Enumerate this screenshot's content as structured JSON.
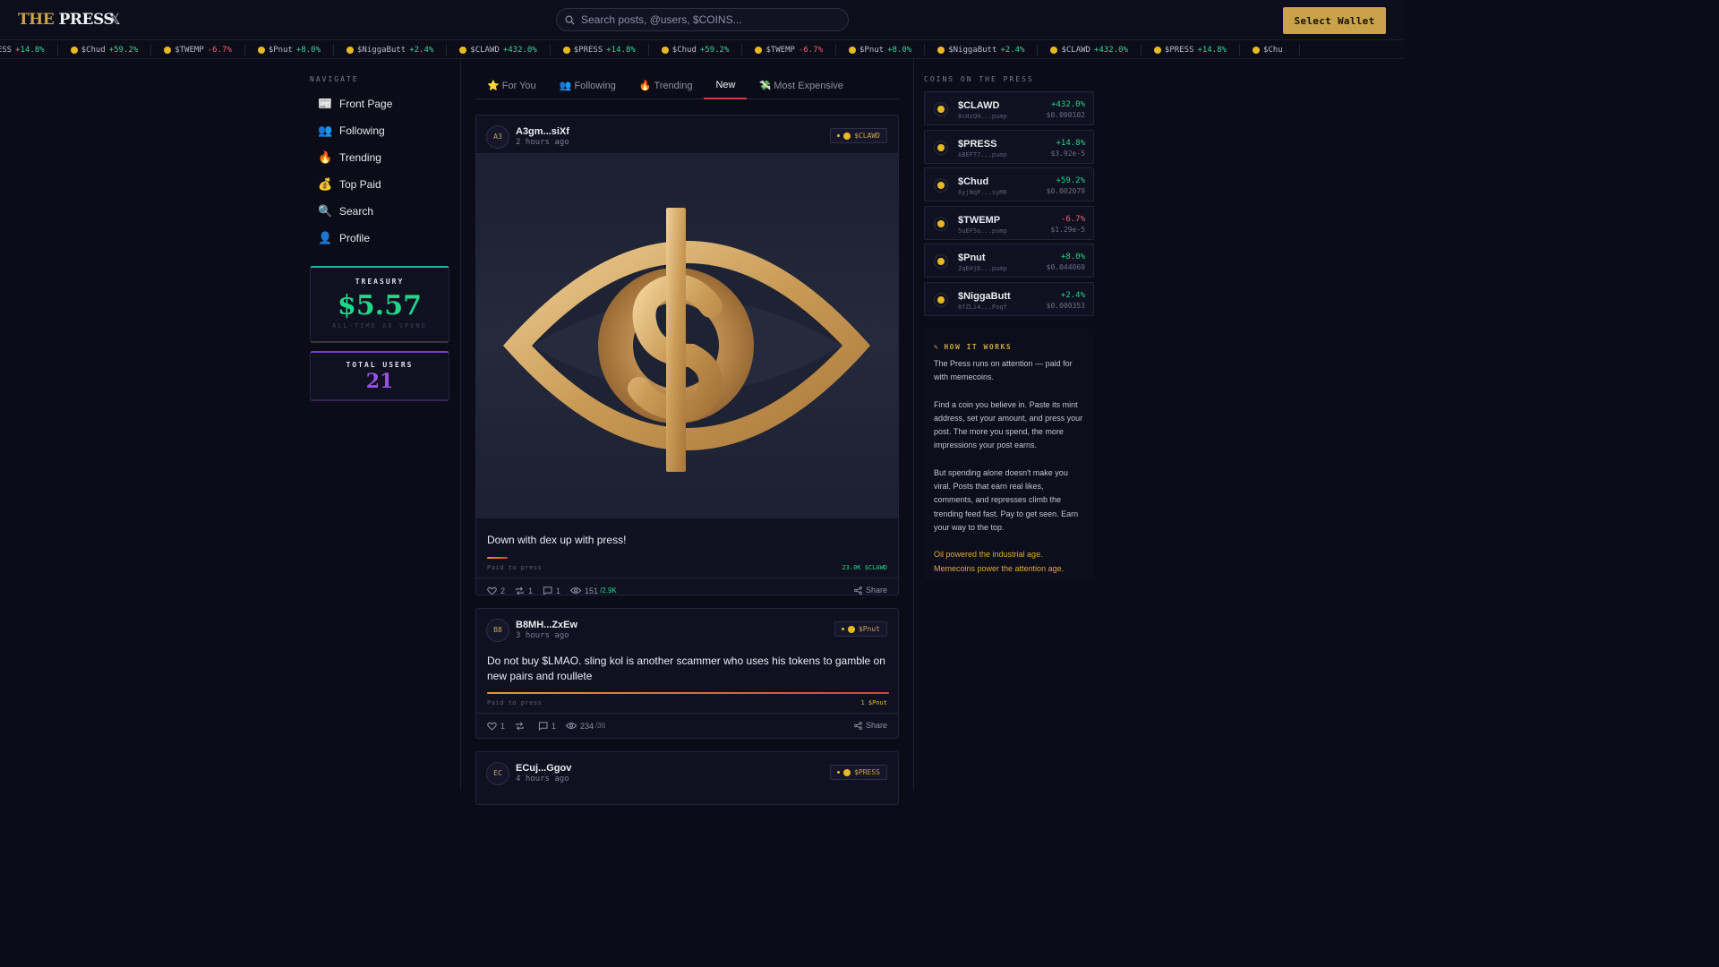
{
  "header": {
    "logo_the": "THE",
    "logo_press": "PRESS",
    "x_icon": "x-logo-icon",
    "search_placeholder": "Search posts, @users, $COINS...",
    "wallet_label": "Select Wallet"
  },
  "ticker": [
    {
      "symbol": "PRESS",
      "change": "+14.8%",
      "dir": "pos",
      "coin": false
    },
    {
      "symbol": "$Chud",
      "change": "+59.2%",
      "dir": "pos",
      "coin": true
    },
    {
      "symbol": "$TWEMP",
      "change": "-6.7%",
      "dir": "neg",
      "coin": true
    },
    {
      "symbol": "$Pnut",
      "change": "+8.0%",
      "dir": "pos",
      "coin": true
    },
    {
      "symbol": "$NiggaButt",
      "change": "+2.4%",
      "dir": "pos",
      "coin": true
    },
    {
      "symbol": "$CLAWD",
      "change": "+432.0%",
      "dir": "pos",
      "coin": true
    },
    {
      "symbol": "$PRESS",
      "change": "+14.8%",
      "dir": "pos",
      "coin": true
    },
    {
      "symbol": "$Chud",
      "change": "+59.2%",
      "dir": "pos",
      "coin": true
    },
    {
      "symbol": "$TWEMP",
      "change": "-6.7%",
      "dir": "neg",
      "coin": true
    },
    {
      "symbol": "$Pnut",
      "change": "+8.0%",
      "dir": "pos",
      "coin": true
    },
    {
      "symbol": "$NiggaButt",
      "change": "+2.4%",
      "dir": "pos",
      "coin": true
    },
    {
      "symbol": "$CLAWD",
      "change": "+432.0%",
      "dir": "pos",
      "coin": true
    },
    {
      "symbol": "$PRESS",
      "change": "+14.8%",
      "dir": "pos",
      "coin": true
    },
    {
      "symbol": "$Chu",
      "change": "",
      "dir": "pos",
      "coin": true
    }
  ],
  "nav": {
    "heading": "NAVIGATE",
    "items": [
      {
        "icon": "📰",
        "label": "Front Page"
      },
      {
        "icon": "👥",
        "label": "Following"
      },
      {
        "icon": "🔥",
        "label": "Trending"
      },
      {
        "icon": "💰",
        "label": "Top Paid"
      },
      {
        "icon": "🔍",
        "label": "Search"
      },
      {
        "icon": "👤",
        "label": "Profile"
      }
    ]
  },
  "stats": {
    "treasury_label": "TREASURY",
    "treasury_value": "$5.57",
    "treasury_sub": "ALL-TIME AD SPEND",
    "users_label": "TOTAL USERS",
    "users_value": "21"
  },
  "tabs": [
    {
      "label": "⭐ For You",
      "active": false
    },
    {
      "label": "👥 Following",
      "active": false
    },
    {
      "label": "🔥 Trending",
      "active": false
    },
    {
      "label": "New",
      "active": true
    },
    {
      "label": "💸 Most Expensive",
      "active": false
    }
  ],
  "posts": [
    {
      "avatar": "A3",
      "author": "A3gm...siXf",
      "time": "2 hours ago",
      "coin": "$CLAWD",
      "text": "Down with dex up with press!",
      "paid_label": "Paid to press",
      "paid_amount": "23.0K $CLAWD",
      "paid_fill": 0.05,
      "likes": "2",
      "reposts": "1",
      "comments": "1",
      "views": "151",
      "views_total": "/2.9K",
      "share": "Share"
    },
    {
      "avatar": "B8",
      "author": "B8MH...ZxEw",
      "time": "3 hours ago",
      "coin": "$Pnut",
      "text": "Do not buy $LMAO. sling kol is another scammer who uses his tokens to gamble on new pairs and roullete",
      "paid_label": "Paid to press",
      "paid_amount": "1 $Pnut",
      "paid_fill": 1.0,
      "likes": "1",
      "reposts": "",
      "comments": "1",
      "views": "234",
      "views_total": "/36",
      "share": "Share"
    },
    {
      "avatar": "EC",
      "author": "ECuj...Ggov",
      "time": "4 hours ago",
      "coin": "$PRESS"
    }
  ],
  "coins": {
    "heading": "COINS ON THE PRESS",
    "items": [
      {
        "name": "$CLAWD",
        "addr": "8cHzQH...pump",
        "change": "+432.0%",
        "dir": "pos",
        "price": "$0.000102"
      },
      {
        "name": "$PRESS",
        "addr": "ABEFT7...pump",
        "change": "+14.8%",
        "dir": "pos",
        "price": "$3.92e-5"
      },
      {
        "name": "$Chud",
        "addr": "6yjNqP...syM6",
        "change": "+59.2%",
        "dir": "pos",
        "price": "$0.002079"
      },
      {
        "name": "$TWEMP",
        "addr": "5uEF5o...pump",
        "change": "-6.7%",
        "dir": "neg",
        "price": "$1.29e-5"
      },
      {
        "name": "$Pnut",
        "addr": "2qEHjD...pump",
        "change": "+8.0%",
        "dir": "pos",
        "price": "$0.044060"
      },
      {
        "name": "$NiggaButt",
        "addr": "8fZLi4...Poqf",
        "change": "+2.4%",
        "dir": "pos",
        "price": "$0.000353"
      }
    ]
  },
  "how": {
    "heading": "HOW IT WORKS",
    "p1": "The Press runs on attention — paid for with memecoins.",
    "p2": "Find a coin you believe in. Paste its mint address, set your amount, and press your post. The more you spend, the more impressions your post earns.",
    "p3": "But spending alone doesn't make you viral. Posts that earn real likes, comments, and represses climb the trending feed fast. Pay to get seen. Earn your way to the top.",
    "p4": "Oil powered the industrial age. Memecoins power the attention age."
  },
  "colors": {
    "accent_gold": "#c9a24a",
    "positive": "#22d688",
    "negative": "#f25f6e",
    "active_tab": "#d23b3b",
    "users_purple": "#9a4fe6"
  }
}
